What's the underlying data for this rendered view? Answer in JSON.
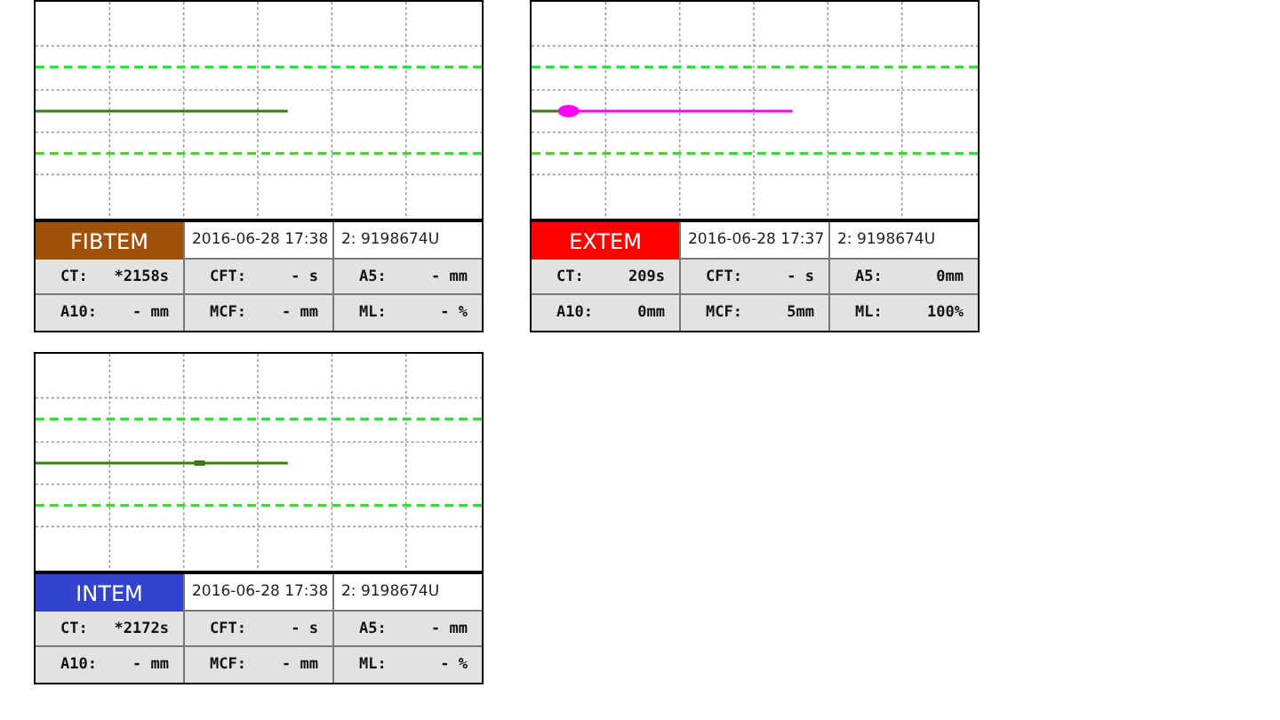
{
  "panels": [
    {
      "test": "FIBTEM",
      "color": "#a0520a",
      "datetime": "2016-06-28  17:38",
      "sample": "2: 9198674U",
      "kind": "plain",
      "metrics": [
        {
          "label": "CT:",
          "value": "*2158s"
        },
        {
          "label": "CFT:",
          "value": "- s"
        },
        {
          "label": "A5:",
          "value": "- mm"
        },
        {
          "label": "A10:",
          "value": "- mm"
        },
        {
          "label": "MCF:",
          "value": "- mm"
        },
        {
          "label": "ML:",
          "value": "- %"
        }
      ]
    },
    {
      "test": "EXTEM",
      "color": "#ff0000",
      "datetime": "2016-06-28  17:37",
      "sample": "2: 9198674U",
      "kind": "dot",
      "metrics": [
        {
          "label": "CT:",
          "value": "209s"
        },
        {
          "label": "CFT:",
          "value": "- s"
        },
        {
          "label": "A5:",
          "value": "0mm"
        },
        {
          "label": "A10:",
          "value": "0mm"
        },
        {
          "label": "MCF:",
          "value": "5mm"
        },
        {
          "label": "ML:",
          "value": "100%"
        }
      ]
    },
    {
      "test": "INTEM",
      "color": "#3344cc",
      "datetime": "2016-06-28  17:38",
      "sample": "2: 9198674U",
      "kind": "square",
      "metrics": [
        {
          "label": "CT:",
          "value": "*2172s"
        },
        {
          "label": "CFT:",
          "value": "- s"
        },
        {
          "label": "A5:",
          "value": "- mm"
        },
        {
          "label": "A10:",
          "value": "- mm"
        },
        {
          "label": "MCF:",
          "value": "- mm"
        },
        {
          "label": "ML:",
          "value": "- %"
        }
      ]
    }
  ]
}
